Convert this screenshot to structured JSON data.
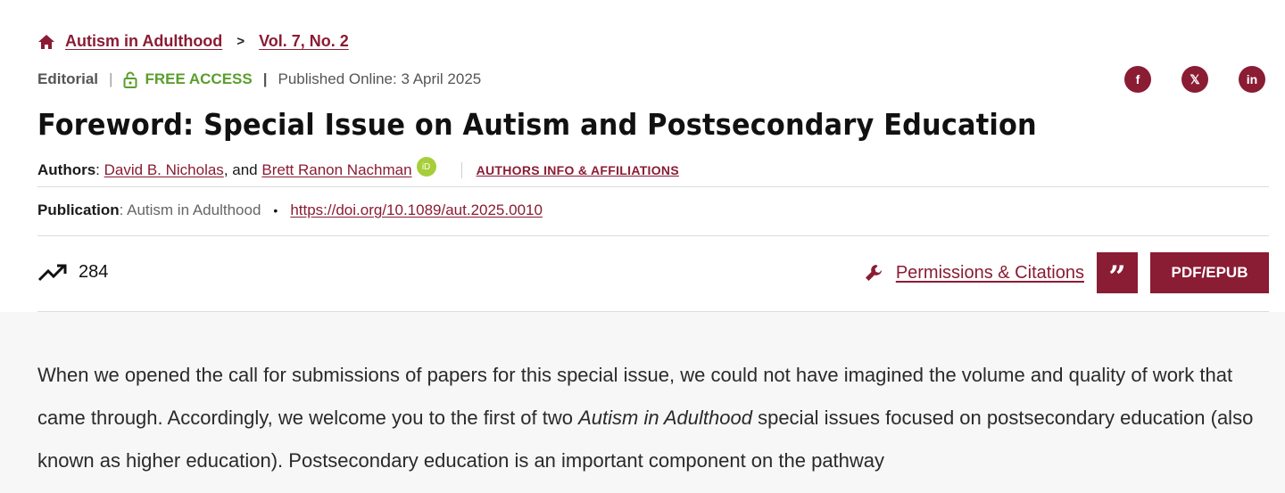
{
  "breadcrumb": {
    "journal": "Autism in Adulthood",
    "separator": ">",
    "issue": "Vol. 7, No. 2"
  },
  "meta": {
    "type": "Editorial",
    "access": "FREE ACCESS",
    "published": "Published Online: 3 April 2025"
  },
  "social": {
    "facebook": "f",
    "x": "𝕏",
    "linkedin": "in"
  },
  "title": "Foreword: Special Issue on Autism and Postsecondary Education",
  "authors": {
    "label": "Authors",
    "colon": ":",
    "author1": "David B. Nicholas",
    "joiner": ", and",
    "author2": "Brett Ranon Nachman",
    "orcid": "iD",
    "info_link": "AUTHORS INFO & AFFILIATIONS"
  },
  "publication": {
    "label": "Publication",
    "journal": ": Autism in Adulthood",
    "dot": "•",
    "doi": "https://doi.org/10.1089/aut.2025.0010"
  },
  "metrics": {
    "views": "284"
  },
  "actions": {
    "permissions": "Permissions & Citations",
    "cite_glyph": "”",
    "pdf": "PDF/EPUB"
  },
  "body": {
    "p1_start": "When we opened the call for submissions of papers for this special issue, we could not have imagined the volume and quality of work that came through. Accordingly, we welcome you to the first of two ",
    "p1_italic": "Autism in Adulthood",
    "p1_end": " special issues focused on postsecondary education (also known as higher education). Postsecondary education is an important component on the pathway"
  },
  "colors": {
    "brand": "#8a1c34",
    "access": "#5a9e2e",
    "orcid": "#a6ce39"
  }
}
